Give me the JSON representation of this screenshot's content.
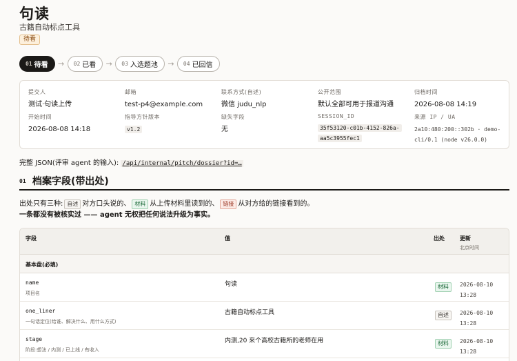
{
  "header": {
    "title": "句读",
    "subtitle": "古籍自动标点工具",
    "status": "待看"
  },
  "stepper": [
    {
      "num": "01",
      "label": "待看",
      "active": true
    },
    {
      "num": "02",
      "label": "已看",
      "active": false
    },
    {
      "num": "03",
      "label": "入选题池",
      "active": false
    },
    {
      "num": "04",
      "label": "已回信",
      "active": false
    }
  ],
  "meta": {
    "submitter": {
      "label": "提交人",
      "value": "测试·句读上传"
    },
    "email": {
      "label": "邮箱",
      "value": "test-p4@example.com"
    },
    "contact": {
      "label": "联系方式(自述)",
      "value": "微信 judu_nlp"
    },
    "scope": {
      "label": "公开范围",
      "value": "默认全部可用于报道沟通"
    },
    "archived": {
      "label": "归档时间",
      "value": "2026-08-08 14:19"
    },
    "started": {
      "label": "开始时间",
      "value": "2026-08-08 14:18"
    },
    "guide": {
      "label": "指导方针版本",
      "value": "v1.2"
    },
    "missing": {
      "label": "缺失字段",
      "value": "无"
    },
    "session": {
      "label": "SESSION_ID",
      "line1": "35f53120-c01b-4152-826a-",
      "line2": "aa5c3955fec1"
    },
    "source": {
      "label": "来源 IP / UA",
      "line1": "2a10:480:200::302b · demo-",
      "line2": "cli/0.1 (node v26.0.0)"
    }
  },
  "json_line": {
    "prefix": "完整 JSON(评审 agent 的输入):",
    "link": "/api/internal/pitch/dossier?id=…"
  },
  "section": {
    "num": "01",
    "title": "档案字段(带出处)"
  },
  "explain": {
    "p1": "出处只有三种:",
    "tag_self": "自述",
    "p2": "对方口头说的、",
    "tag_mat": "材料",
    "p3": "从上传材料里读到的、",
    "tag_link": "链接",
    "p4": "从对方给的链接看到的。",
    "p5": "一条都没有被核实过 —— agent 无权把任何说法升级为事实。"
  },
  "table": {
    "headers": {
      "field": "字段",
      "value": "值",
      "source": "出处",
      "updated": "更新",
      "updated_sub": "北京时间"
    },
    "group": "基本盘(必填)",
    "rows": [
      {
        "name": "name",
        "desc": "项目名",
        "value": "句读",
        "source": "材料",
        "date": "2026-08-10",
        "time": "13:28"
      },
      {
        "name": "one_liner",
        "desc": "一句话定位(给谁、解决什么、用什么方式)",
        "value": "古籍自动标点工具",
        "source": "自述",
        "date": "2026-08-10",
        "time": "13:28"
      },
      {
        "name": "stage",
        "desc": "阶段:想法 / 内测 / 已上线 / 有收入",
        "value": "内测,20 来个高校古籍所的老师在用",
        "source": "材料",
        "date": "2026-08-10",
        "time": "13:28"
      }
    ]
  }
}
